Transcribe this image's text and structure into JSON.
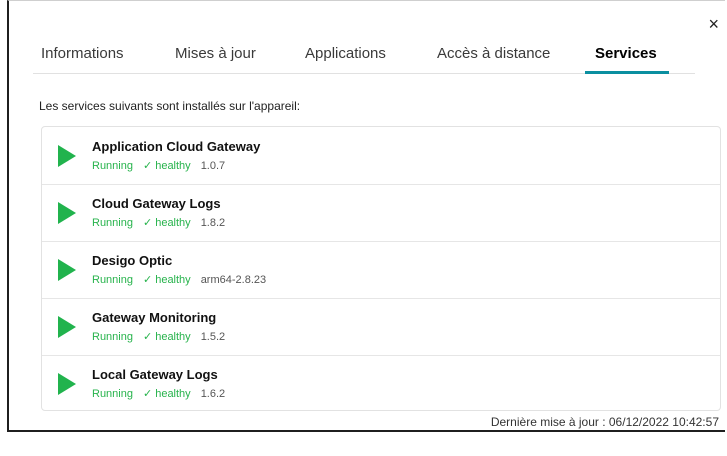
{
  "dialog": {
    "close_icon": "×"
  },
  "tabs": [
    {
      "label": "Informations"
    },
    {
      "label": "Mises à jour"
    },
    {
      "label": "Applications"
    },
    {
      "label": "Accès à distance"
    },
    {
      "label": "Services",
      "active": true
    }
  ],
  "intro": "Les services suivants sont installés sur l'appareil:",
  "services": [
    {
      "name": "Application Cloud Gateway",
      "status": "Running",
      "check": "✓",
      "health": "healthy",
      "version": "1.0.7"
    },
    {
      "name": "Cloud Gateway Logs",
      "status": "Running",
      "check": "✓",
      "health": "healthy",
      "version": "1.8.2"
    },
    {
      "name": "Desigo Optic",
      "status": "Running",
      "check": "✓",
      "health": "healthy",
      "version": "arm64-2.8.23"
    },
    {
      "name": "Gateway Monitoring",
      "status": "Running",
      "check": "✓",
      "health": "healthy",
      "version": "1.5.2"
    },
    {
      "name": "Local Gateway Logs",
      "status": "Running",
      "check": "✓",
      "health": "healthy",
      "version": "1.6.2"
    }
  ],
  "footer": "Dernière mise à jour : 06/12/2022 10:42:57",
  "colors": {
    "accent": "#0b8fa0",
    "running": "#21b34d"
  },
  "icons": {
    "service": "play-icon",
    "close": "close-icon",
    "health": "check-icon"
  }
}
